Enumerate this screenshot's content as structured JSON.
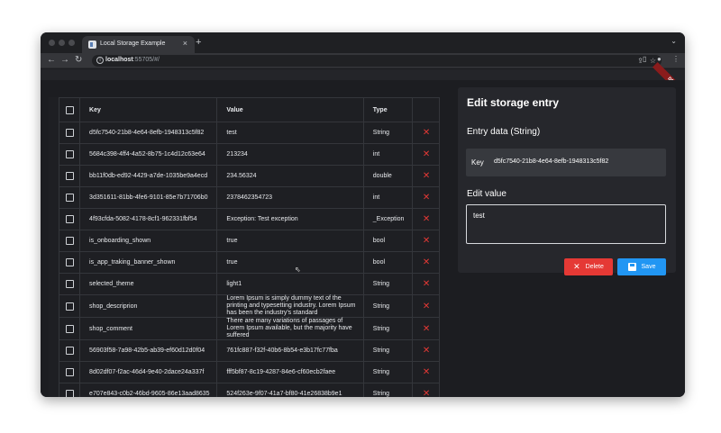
{
  "browser": {
    "tab_title": "Local Storage Example",
    "tab_close": "×",
    "new_tab": "+",
    "tab_menu": "⌄",
    "url_host": "localhost",
    "url_rest": ":55705/#/",
    "back": "←",
    "forward": "→",
    "reload": "↻",
    "share": "⇪",
    "star": "☆",
    "sidepanel": "▯",
    "profile": "●",
    "menu": "⋮",
    "info": "i"
  },
  "debug_banner": "DEBUG",
  "table": {
    "headers": {
      "key": "Key",
      "value": "Value",
      "type": "Type"
    },
    "rows": [
      {
        "key": "d5fc7540-21b8-4e64-8efb-1948313c5f82",
        "value": "test",
        "type": "String"
      },
      {
        "key": "5684c398-4ff4-4a52-8b75-1c4d12c63e64",
        "value": "213234",
        "type": "int"
      },
      {
        "key": "bb11f0db-ed92-4429-a7de-1035be9a4ecd",
        "value": "234.56324",
        "type": "double"
      },
      {
        "key": "3d351611-81bb-4fe6-9101-85e7b71706b0",
        "value": "2378462354723",
        "type": "int"
      },
      {
        "key": "4f93cfda-5082-4178-8cf1-962331fbf54",
        "value": "Exception: Test exception",
        "type": "_Exception"
      },
      {
        "key": "is_onboarding_shown",
        "value": "true",
        "type": "bool"
      },
      {
        "key": "is_app_traking_banner_shown",
        "value": "true",
        "type": "bool"
      },
      {
        "key": "selected_theme",
        "value": "light1",
        "type": "String"
      },
      {
        "key": "shop_descriprion",
        "value": "Lorem Ipsum is simply dummy text of the printing and typesetting industry. Lorem Ipsum has been the industry's standard",
        "type": "String"
      },
      {
        "key": "shop_comment",
        "value": "There are many variations of passages of Lorem Ipsum available, but the majority have suffered",
        "type": "String"
      },
      {
        "key": "56903f58-7a98-42b5-ab39-ef60d12d0f04",
        "value": "761fc887-f32f-40b6-8b54-e3b17fc77fba",
        "type": "String"
      },
      {
        "key": "8d02df07-f2ac-46d4-9e40-2dace24a337f",
        "value": "fff5bf87-8c19-4287-84e6-cf60ecb2faee",
        "type": "String"
      },
      {
        "key": "e707e843-c0b2-46bd-9605-86e13aad8635",
        "value": "524f263e-9f07-41a7-bf80-41e26838b9e1",
        "type": "String"
      }
    ],
    "delete_glyph": "✕"
  },
  "editor": {
    "title": "Edit storage entry",
    "entry_label": "Entry data (String)",
    "key_label": "Key",
    "key_value": "d5fc7540-21b8-4e64-8efb-1948313c5f82",
    "edit_label": "Edit value",
    "edit_value": "test",
    "delete_label": "Delete",
    "save_label": "Save",
    "delete_icon": "✕"
  },
  "colors": {
    "background": "#1c1d21",
    "panel": "#26272c",
    "delete": "#e53935",
    "save": "#2196f3"
  }
}
